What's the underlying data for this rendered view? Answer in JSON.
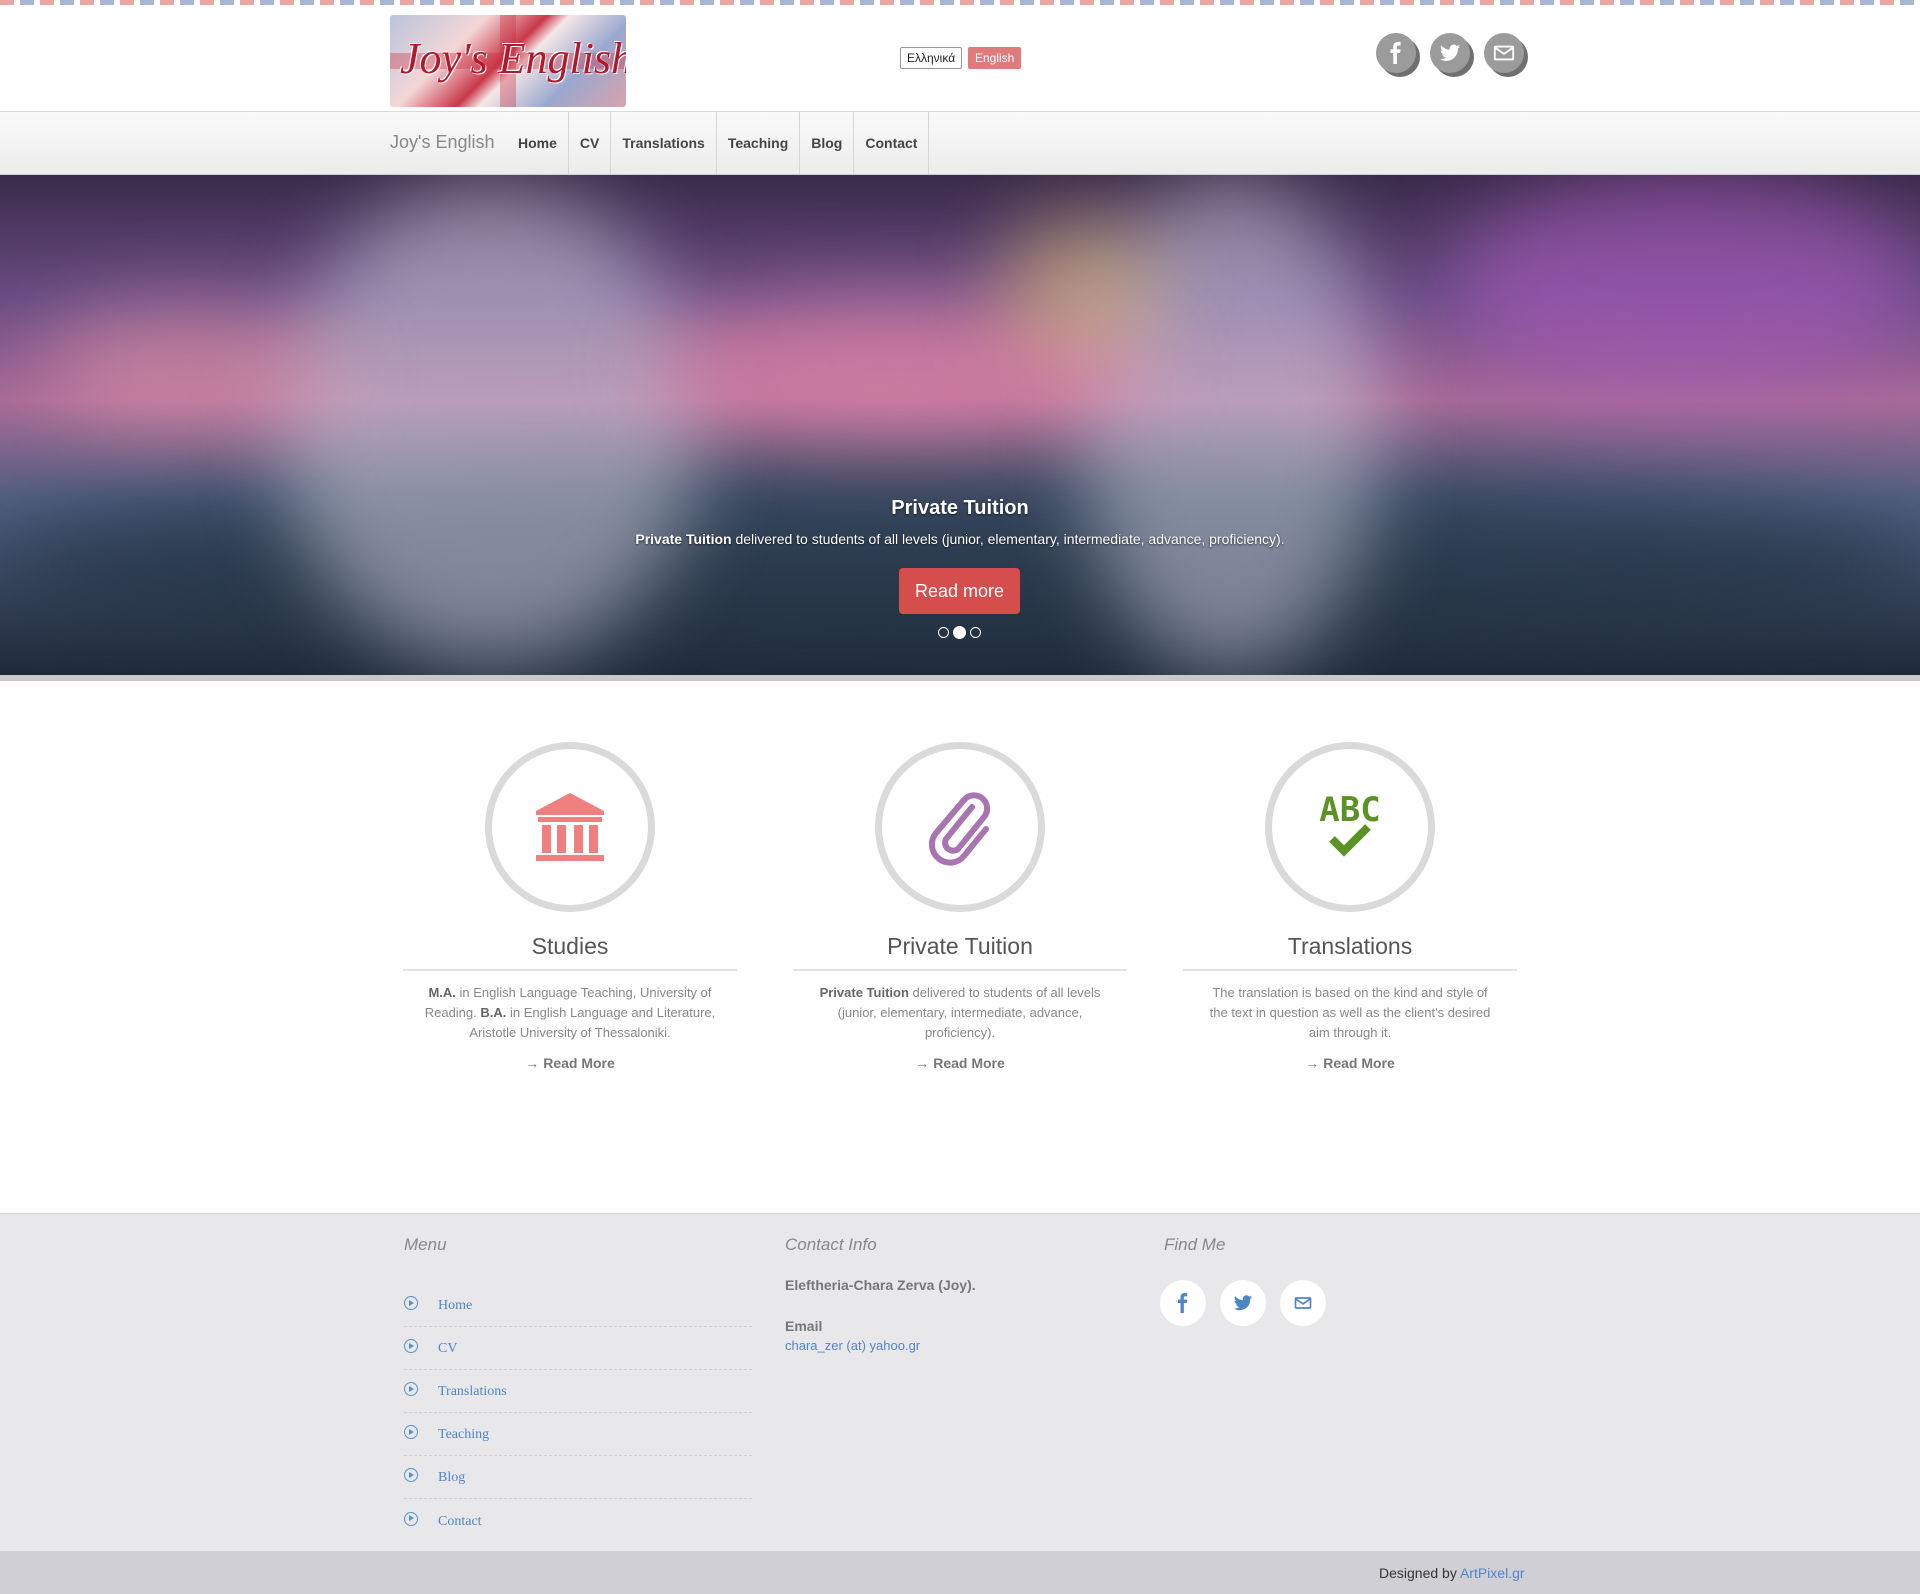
{
  "header": {
    "logo_text": "Joy's English",
    "languages": [
      "Ελληνικά",
      "English"
    ],
    "active_language": "English",
    "social_icons": [
      "facebook-icon",
      "twitter-icon",
      "mail-icon"
    ]
  },
  "nav": {
    "brand": "Joy's English",
    "items": [
      "Home",
      "CV",
      "Translations",
      "Teaching",
      "Blog",
      "Contact"
    ]
  },
  "hero": {
    "title": "Private Tuition",
    "text_bold": "Private Tuition",
    "text_rest": " delivered to students of all levels (junior, elementary, intermediate, advance, proficiency).",
    "button": "Read more",
    "slides": 3,
    "active_slide": 2
  },
  "features": [
    {
      "title": "Studies",
      "icon": "bank-icon",
      "desc_parts": [
        {
          "b": "M.A."
        },
        {
          "t": " in English Language Teaching, University of Reading. "
        },
        {
          "b": "B.A."
        },
        {
          "t": " in English Language and Literature, Aristotle University of Thessaloniki."
        }
      ],
      "link": "Read More"
    },
    {
      "title": "Private Tuition",
      "icon": "paperclip-icon",
      "desc_parts": [
        {
          "b": "Private Tuition"
        },
        {
          "t": " delivered to students of all levels (junior, elementary, intermediate, advance, proficiency)."
        }
      ],
      "link": "Read More"
    },
    {
      "title": "Translations",
      "icon": "spellcheck-icon",
      "icon_text": "ABC",
      "desc_parts": [
        {
          "t": "The translation is based on the kind and style of the text in question as well as the client's desired aim through it."
        }
      ],
      "link": "Read More"
    }
  ],
  "colors": {
    "accent_red": "#d64d4d",
    "bank_icon": "#f08080",
    "paperclip_icon": "#a875b2",
    "abc_icon": "#5b9226",
    "link_blue": "#4f86c6"
  },
  "footer": {
    "menu_heading": "Menu",
    "menu": [
      "Home",
      "CV",
      "Translations",
      "Teaching",
      "Blog",
      "Contact"
    ],
    "contact_heading": "Contact Info",
    "contact_name": "Eleftheria-Chara Zerva (Joy).",
    "email_label": "Email",
    "email": "chara_zer (at) yahoo.gr",
    "find_heading": "Find Me",
    "social_icons": [
      "facebook-icon",
      "twitter-icon",
      "mail-icon"
    ]
  },
  "credit": {
    "prefix": "Designed by ",
    "link": "ArtPixel.gr"
  }
}
